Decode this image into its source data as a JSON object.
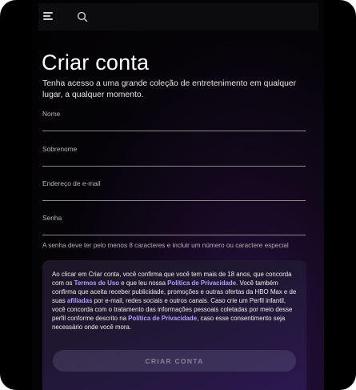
{
  "topbar": {
    "menu_icon": "hamburger-menu-icon",
    "search_icon": "search-icon"
  },
  "page": {
    "title": "Criar conta",
    "subtitle": "Tenha acesso a uma grande coleção de entretenimento em qualquer lugar, a qualquer momento."
  },
  "form": {
    "fields": [
      {
        "label": "Nome",
        "value": ""
      },
      {
        "label": "Sobrenome",
        "value": ""
      },
      {
        "label": "Endereço de e-mail",
        "value": ""
      },
      {
        "label": "Senha",
        "value": ""
      }
    ],
    "password_hint": "A senha deve ter pelo menos 8 caracteres e incluir um número ou caractere especial"
  },
  "terms": {
    "t1": "Ao clicar em Criar conta, você confirma que você tem mais de 18 anos, que concorda com os ",
    "link_terms": "Termos de Uso",
    "t2": " e que leu nossa ",
    "link_privacy_1": "Política de Privacidade",
    "t3": ". Você também confirma que aceita receber publicidade, promoções e outras ofertas da HBO Max e de suas ",
    "link_affiliates": "afiliadas",
    "t4": " por e-mail, redes sociais e outros canais. Caso crie um Perfil infantil, você concorda com o tratamento das informações pessoais coletadas por meio desse perfil conforme descrito na ",
    "link_privacy_2": "Política de Privacidade",
    "t5": ", caso esse consentimento seja necessário onde você mora."
  },
  "actions": {
    "create_account_label": "CRIAR CONTA"
  },
  "colors": {
    "background": "#050307",
    "link": "#b49bff",
    "button_disabled": "#3a3548"
  }
}
